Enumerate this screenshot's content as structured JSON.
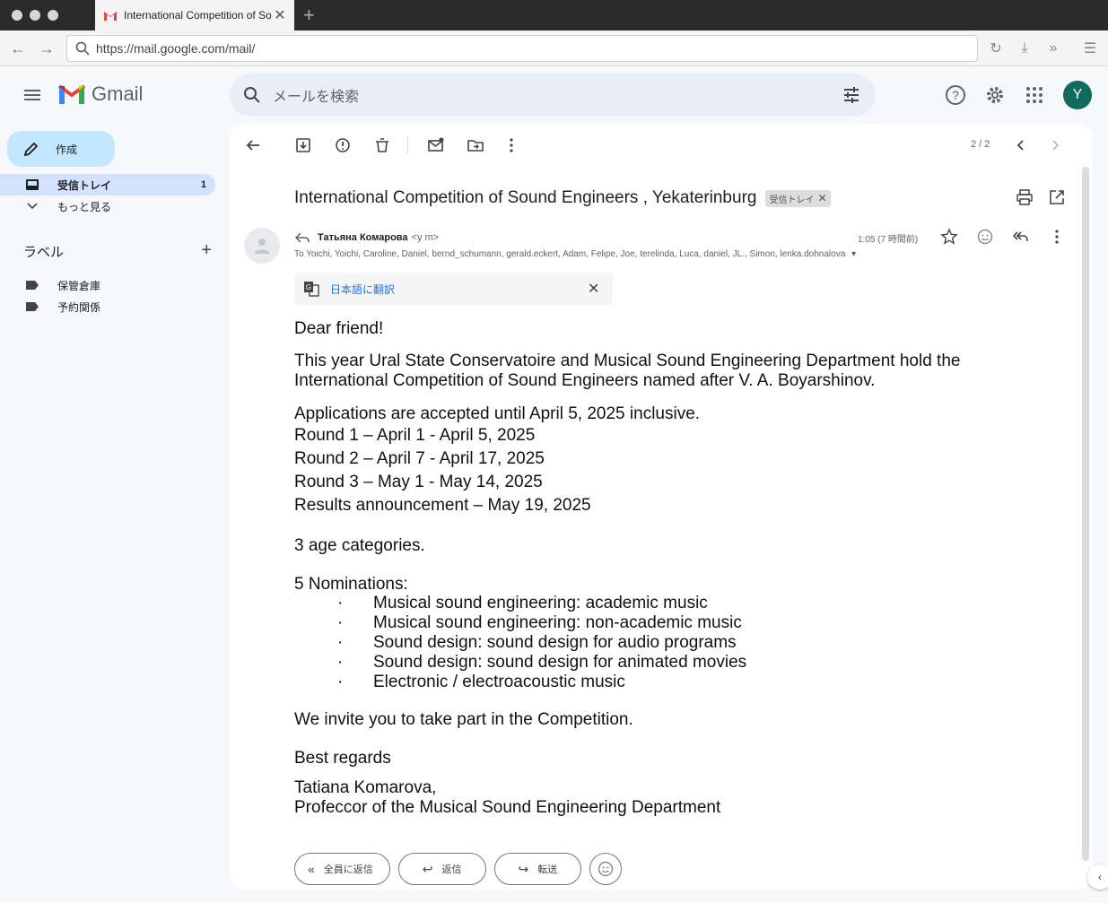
{
  "browser": {
    "tab_title": "International Competition of So",
    "url": "https://mail.google.com/mail/"
  },
  "gmail": {
    "brand": "Gmail",
    "search_placeholder": "メールを検索",
    "avatar_letter": "Y",
    "compose_label": "作成",
    "nav": [
      {
        "label": "受信トレイ",
        "count": "1"
      },
      {
        "label": "もっと見る",
        "count": ""
      }
    ],
    "labels_heading": "ラベル",
    "labels": [
      "保管倉庫",
      "予約関係"
    ]
  },
  "toolbar": {
    "pager": "2 / 2"
  },
  "message": {
    "subject": "International Competition of Sound Engineers , Yekaterinburg",
    "chip": "受信トレイ",
    "sender_name": "Татьяна Комарова",
    "sender_email": "<y                          m>",
    "recipients": "To Yoichi, Yoichi, Caroline, Daniel, bernd_schumann, gerald.eckert, Adam, Felipe, Joe, terelinda, Luca, daniel, JL., Simon, lenka.dohnalova",
    "time": "1:05 (7 時間前)",
    "translate_label": "日本語に翻訳",
    "body": {
      "greeting": "Dear friend!",
      "intro_1": "This year Ural State Conservatoire and Musical Sound Engineering Department hold the",
      "intro_2": "International Competition of Sound Engineers named  after V.  A.  Boyarshinov.",
      "apps": "Applications are accepted until April 5, 2025 inclusive.",
      "round1": "Round 1 –   April 1 - April 5, 2025",
      "round2": "Round 2 – April 7 - April 17, 2025",
      "round3": "Round 3 – May 1 - May 14, 2025",
      "results": "Results announcement – May 19, 2025",
      "age": "3 age categories.",
      "nominations_head": "5 Nominations:",
      "nominations": [
        "Musical sound engineering: academic music",
        "Musical sound engineering: non-academic music",
        "Sound design: sound design for audio programs",
        "Sound design: sound design for animated movies",
        "Electronic / electroacoustic music"
      ],
      "invite": "We invite you to take part in the Competition.",
      "regards": "Best regards",
      "sig_1": "Tatiana Komarova,",
      "sig_2": "Profeccor  of the  Musical Sound Engineering Department"
    },
    "reply_all": "全員に返信",
    "reply": "返信",
    "forward": "転送"
  },
  "colors": {
    "accent": "#0b57d0",
    "compose_bg": "#c2e7ff",
    "active_nav": "#d3e3fd",
    "avatar_bg": "#0f6b5c"
  }
}
